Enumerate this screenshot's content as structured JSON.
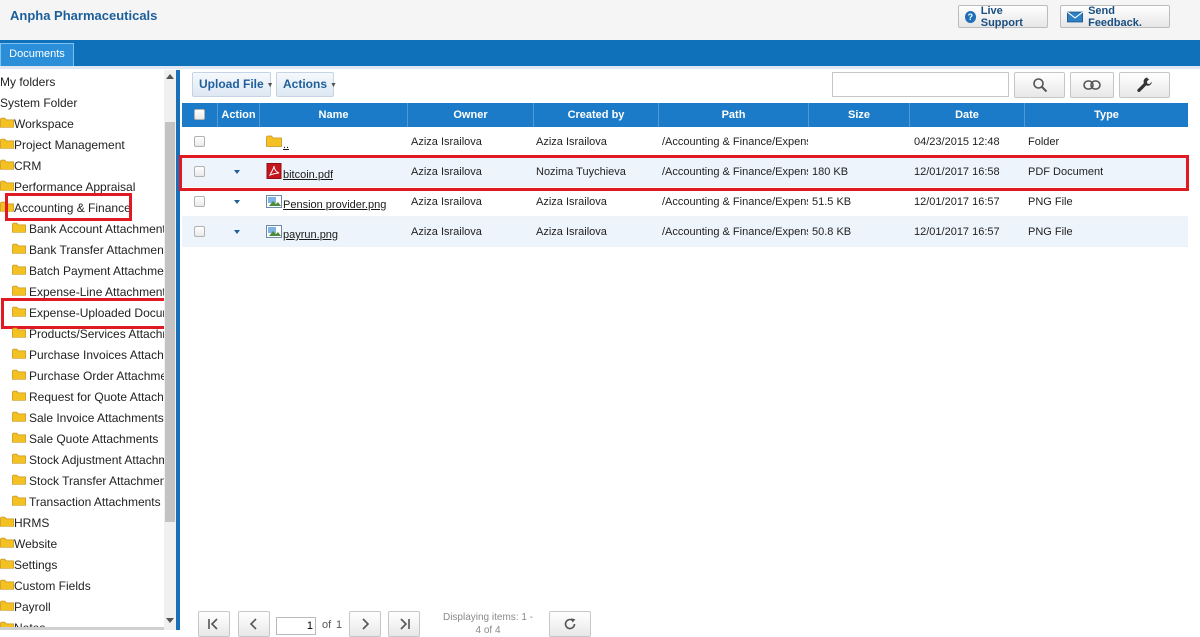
{
  "header": {
    "app_title": "Anpha Pharmaceuticals",
    "live_support_label": "Live Support",
    "send_feedback_label": "Send Feedback."
  },
  "tabs": [
    {
      "label": "Documents",
      "active": true
    }
  ],
  "toolbar": {
    "upload_label": "Upload File",
    "actions_label": "Actions",
    "search_value": ""
  },
  "tree": {
    "items": [
      {
        "label": "My folders",
        "level": 0,
        "folder": false
      },
      {
        "label": "System Folder",
        "level": 0,
        "folder": false
      },
      {
        "label": "Workspace",
        "level": 1,
        "folder": true
      },
      {
        "label": "Project Management",
        "level": 1,
        "folder": true
      },
      {
        "label": "CRM",
        "level": 1,
        "folder": true
      },
      {
        "label": "Performance Appraisal",
        "level": 1,
        "folder": true
      },
      {
        "label": "Accounting & Finance",
        "level": 1,
        "folder": true,
        "highlighted": true
      },
      {
        "label": "Bank Account Attachments",
        "level": 2,
        "folder": true
      },
      {
        "label": "Bank Transfer Attachments",
        "level": 2,
        "folder": true
      },
      {
        "label": "Batch Payment Attachments",
        "level": 2,
        "folder": true
      },
      {
        "label": "Expense-Line Attachments",
        "level": 2,
        "folder": true
      },
      {
        "label": "Expense-Uploaded Documents",
        "level": 2,
        "folder": true,
        "highlighted": true,
        "selected": true
      },
      {
        "label": "Products/Services Attachments",
        "level": 2,
        "folder": true
      },
      {
        "label": "Purchase Invoices Attachments",
        "level": 2,
        "folder": true
      },
      {
        "label": "Purchase Order Attachments",
        "level": 2,
        "folder": true
      },
      {
        "label": "Request for Quote Attachments",
        "level": 2,
        "folder": true
      },
      {
        "label": "Sale Invoice Attachments",
        "level": 2,
        "folder": true
      },
      {
        "label": "Sale Quote Attachments",
        "level": 2,
        "folder": true
      },
      {
        "label": "Stock Adjustment Attachments",
        "level": 2,
        "folder": true
      },
      {
        "label": "Stock Transfer Attachments",
        "level": 2,
        "folder": true
      },
      {
        "label": "Transaction Attachments",
        "level": 2,
        "folder": true
      },
      {
        "label": "HRMS",
        "level": 1,
        "folder": true
      },
      {
        "label": "Website",
        "level": 1,
        "folder": true
      },
      {
        "label": "Settings",
        "level": 1,
        "folder": true
      },
      {
        "label": "Custom Fields",
        "level": 1,
        "folder": true
      },
      {
        "label": "Payroll",
        "level": 1,
        "folder": true
      },
      {
        "label": "Notes",
        "level": 1,
        "folder": true
      }
    ]
  },
  "grid": {
    "columns": [
      "Action",
      "Name",
      "Owner",
      "Created by",
      "Path",
      "Size",
      "Date",
      "Type"
    ],
    "rows": [
      {
        "icon": "folder-icon",
        "name": "..",
        "owner": "Aziza Israilova",
        "created_by": "Aziza Israilova",
        "path": "/Accounting & Finance/Expense-Uploaded Documents",
        "size": "",
        "date": "04/23/2015 12:48",
        "type": "Folder",
        "has_action": false
      },
      {
        "icon": "pdf-icon",
        "name": "bitcoin.pdf",
        "owner": "Aziza Israilova",
        "created_by": "Nozima Tuychieva",
        "path": "/Accounting & Finance/Expense-Uploaded Documents",
        "size": "180 KB",
        "date": "12/01/2017 16:58",
        "type": "PDF Document",
        "has_action": true,
        "highlighted": true
      },
      {
        "icon": "image-icon",
        "name": "Pension provider.png",
        "owner": "Aziza Israilova",
        "created_by": "Aziza Israilova",
        "path": "/Accounting & Finance/Expense-Uploaded Documents",
        "size": "51.5 KB",
        "date": "12/01/2017 16:57",
        "type": "PNG File",
        "has_action": true
      },
      {
        "icon": "image-icon",
        "name": "payrun.png",
        "owner": "Aziza Israilova",
        "created_by": "Aziza Israilova",
        "path": "/Accounting & Finance/Expense-Uploaded Documents",
        "size": "50.8 KB",
        "date": "12/01/2017 16:57",
        "type": "PNG File",
        "has_action": true
      }
    ]
  },
  "pager": {
    "current_page": "1",
    "of_label": "of",
    "total_pages": "1",
    "displaying_text": "Displaying items: 1 - 4 of 4"
  },
  "colors": {
    "header_blue": "#1b7bc8",
    "tab_strip": "#0f71b9",
    "highlight_red": "#e01a22",
    "folder_yellow": "#f3c122"
  }
}
